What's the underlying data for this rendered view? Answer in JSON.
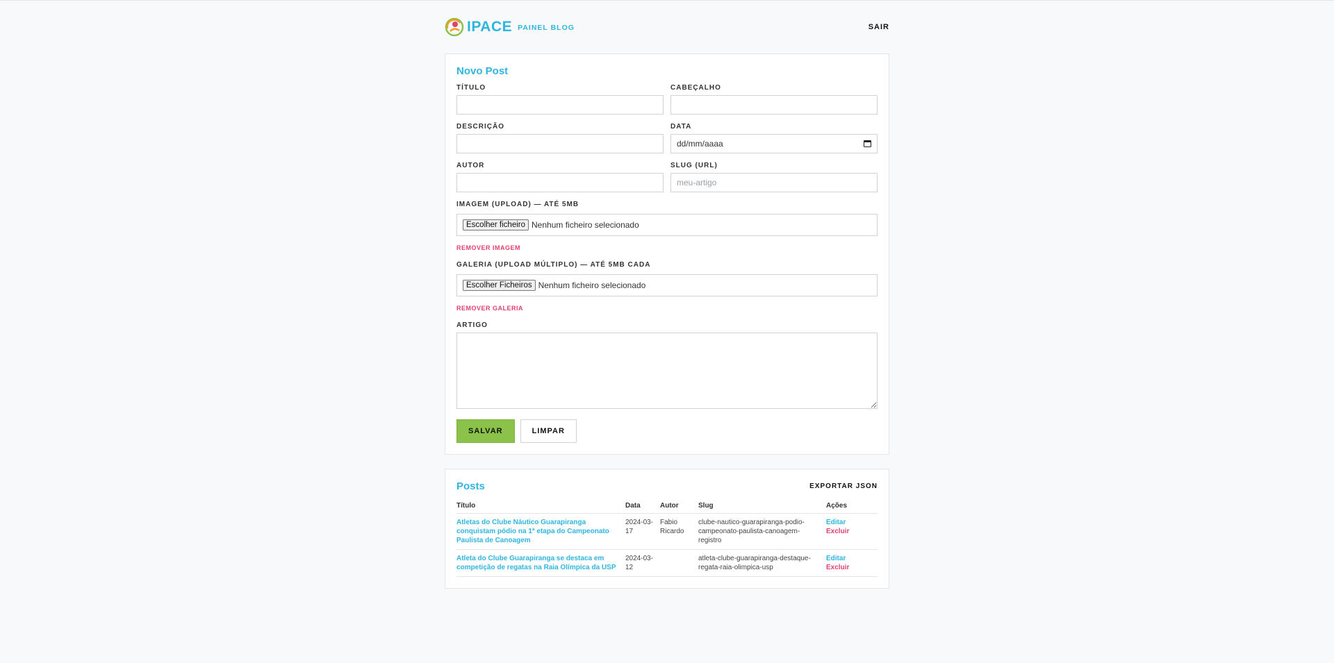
{
  "header": {
    "logo_text": "IPACE",
    "panel_label": "PAINEL BLOG",
    "logout_label": "SAIR"
  },
  "form": {
    "title": "Novo Post",
    "titulo_label": "TÍTULO",
    "cabecalho_label": "CABEÇALHO",
    "descricao_label": "DESCRIÇÃO",
    "data_label": "DATA",
    "data_placeholder": "dd/mm/aaaa",
    "autor_label": "AUTOR",
    "slug_label": "SLUG (URL)",
    "slug_placeholder": "meu-artigo",
    "imagem_label": "IMAGEM (UPLOAD) — ATÉ 5MB",
    "imagem_button": "Escolher ficheiro",
    "imagem_status": "Nenhum ficheiro selecionado",
    "remover_imagem": "REMOVER IMAGEM",
    "galeria_label": "GALERIA (UPLOAD MÚLTIPLO) — ATÉ 5MB CADA",
    "galeria_button": "Escolher Ficheiros",
    "galeria_status": "Nenhum ficheiro selecionado",
    "remover_galeria": "REMOVER GALERIA",
    "artigo_label": "ARTIGO",
    "save_label": "SALVAR",
    "clear_label": "LIMPAR"
  },
  "posts": {
    "title": "Posts",
    "export_label": "EXPORTAR JSON",
    "columns": [
      "Título",
      "Data",
      "Autor",
      "Slug",
      "Ações"
    ],
    "rows": [
      {
        "title": "Atletas do Clube Náutico Guarapiranga conquistam pódio na 1ª etapa do Campeonato Paulista de Canoagem",
        "date": "2024-03-17",
        "author": "Fabio Ricardo",
        "slug": "clube-nautico-guarapiranga-podio-campeonato-paulista-canoagem-registro",
        "edit": "Editar",
        "delete": "Excluir"
      },
      {
        "title": "Atleta do Clube Guarapiranga se destaca em competição de regatas na Raia Olímpica da USP",
        "date": "2024-03-12",
        "author": "",
        "slug": "atleta-clube-guarapiranga-destaque-regata-raia-olimpica-usp",
        "edit": "Editar",
        "delete": "Excluir"
      }
    ]
  },
  "colors": {
    "accent": "#2fb6de",
    "save": "#8bc34a",
    "danger": "#e0416f"
  }
}
